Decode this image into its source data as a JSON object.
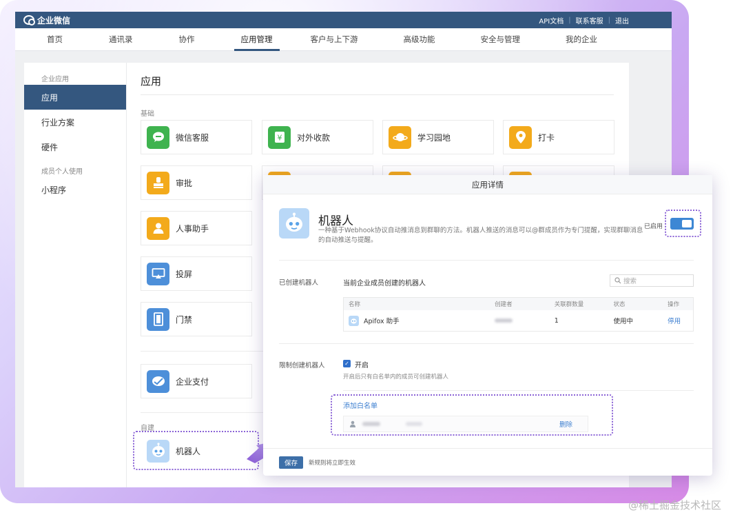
{
  "topbar": {
    "brand": "企业微信",
    "links": [
      "API文档",
      "联系客服",
      "退出"
    ]
  },
  "nav": {
    "items": [
      "首页",
      "通讯录",
      "协作",
      "应用管理",
      "客户与上下游",
      "高级功能",
      "安全与管理",
      "我的企业"
    ],
    "active_index": 3
  },
  "sidebar": {
    "group1": "企业应用",
    "items1": [
      "应用",
      "行业方案",
      "硬件"
    ],
    "group2": "成员个人使用",
    "items2": [
      "小程序"
    ]
  },
  "content": {
    "title": "应用",
    "section_basic": "基础",
    "section_custom": "自建",
    "apps": {
      "wechat_service": "微信客服",
      "payment": "对外收款",
      "learning": "学习园地",
      "checkin": "打卡",
      "approval": "审批",
      "hr": "人事助手",
      "screencast": "投屏",
      "access": "门禁",
      "enterprise_pay": "企业支付",
      "robot": "机器人"
    }
  },
  "modal": {
    "header": "应用详情",
    "title": "机器人",
    "description": "一种基于Webhook协议自动推消息到群聊的方法。机器人推送的消息可以@群成员作为专门提醒，实现群聊消息的自动推送与提醒。",
    "enabled_label": "已启用",
    "created_label": "已创建机器人",
    "created_desc": "当前企业成员创建的机器人",
    "search_placeholder": "搜索",
    "table": {
      "headers": [
        "名称",
        "创建者",
        "关联群数量",
        "状态",
        "操作"
      ],
      "rows": [
        {
          "name": "Apifox 助手",
          "groups": "1",
          "status": "使用中",
          "action": "停用"
        }
      ]
    },
    "restrict_label": "限制创建机器人",
    "restrict_option": "开启",
    "restrict_hint": "开启后只有白名单内的成员可创建机器人",
    "whitelist_add": "添加白名单",
    "whitelist_delete": "删除",
    "save_button": "保存",
    "footer_hint": "新规则将立即生效"
  },
  "watermark": "@稀土掘金技术社区",
  "colors": {
    "brand": "#34577f",
    "accent": "#3d87d4",
    "highlight": "#8a62d6"
  }
}
